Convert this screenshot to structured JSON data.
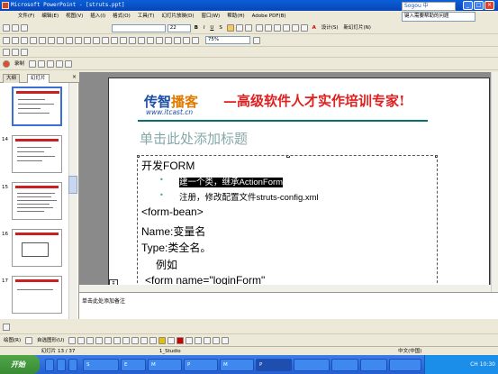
{
  "window": {
    "title": "Microsoft PowerPoint - [struts.ppt]",
    "controls": [
      "_",
      "□",
      "×"
    ]
  },
  "sogou": {
    "logo": "Sogou 中"
  },
  "menu": {
    "items": [
      "文件(F)",
      "编辑(E)",
      "视图(V)",
      "插入(I)",
      "格式(O)",
      "工具(T)",
      "幻灯片放映(D)",
      "窗口(W)",
      "帮助(H)",
      "Adobe PDF(B)"
    ]
  },
  "help_search": {
    "value": "键入需要帮助的问题"
  },
  "format_toolbar": {
    "font_size": "22",
    "bold": "B",
    "italic": "I",
    "underline": "U",
    "shadow": "S",
    "font_color": "A",
    "design": "设计(S)",
    "new_slide": "新幻灯片(N)"
  },
  "std_toolbar": {
    "zoom": "75%"
  },
  "record_toolbar": {
    "record": "录制"
  },
  "left_panel": {
    "tabs": [
      "大纲",
      "幻灯片"
    ],
    "close": "×",
    "slide_numbers": [
      "14",
      "15",
      "16",
      "17"
    ]
  },
  "slide": {
    "logo_text": "传智播客",
    "logo_text_accent_index": 2,
    "logo_url": "www.itcast.cn",
    "banner": "—高级软件人才实作培训专家!",
    "title_placeholder": "单击此处添加标题",
    "body": {
      "heading": "开发FORM",
      "bullet1": "建一个类，继承ActionForm",
      "bullet2": "注册，修改配置文件struts-config.xml",
      "line3": "<form-bean>",
      "line4": "Name:变量名",
      "line5": "Type:类全名。",
      "line6": "例如",
      "line7": "<form  name=\"loginForm\""
    },
    "accent_color": "#0a6f6f",
    "banner_color": "#e02020",
    "logo_color": "#1d4ea3"
  },
  "notes": {
    "placeholder": "单击此处添加备注"
  },
  "drawing_toolbar": {
    "draw": "绘图(R)",
    "autoshapes": "自选图形(U)"
  },
  "status": {
    "slide_info": "幻灯片 13 / 37",
    "template": "1_Studio",
    "language": "中文(中国)"
  },
  "taskbar": {
    "start": "开始",
    "tasks": [
      "S",
      "E",
      "M",
      "P",
      "M",
      "P"
    ],
    "tray": "CH 10:30"
  }
}
